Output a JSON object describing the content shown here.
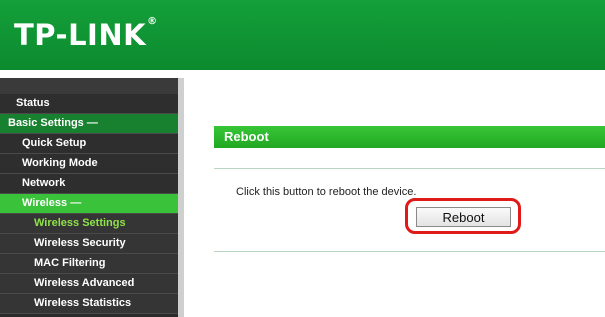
{
  "header": {
    "brand": "TP-LINK",
    "brand_mark": "®"
  },
  "sidebar": {
    "items": [
      {
        "label": "Status"
      },
      {
        "label": "Basic Settings —"
      },
      {
        "label": "Quick Setup"
      },
      {
        "label": "Working Mode"
      },
      {
        "label": "Network"
      },
      {
        "label": "Wireless —"
      },
      {
        "label": "Wireless Settings"
      },
      {
        "label": "Wireless Security"
      },
      {
        "label": "MAC Filtering"
      },
      {
        "label": "Wireless Advanced"
      },
      {
        "label": "Wireless Statistics"
      }
    ]
  },
  "main": {
    "panel_title": "Reboot",
    "description": "Click this button to reboot the device.",
    "reboot_button": "Reboot"
  },
  "colors": {
    "brand_green": "#0c8a2e",
    "accent_green": "#3bc23b",
    "highlight_red": "#e01919"
  }
}
